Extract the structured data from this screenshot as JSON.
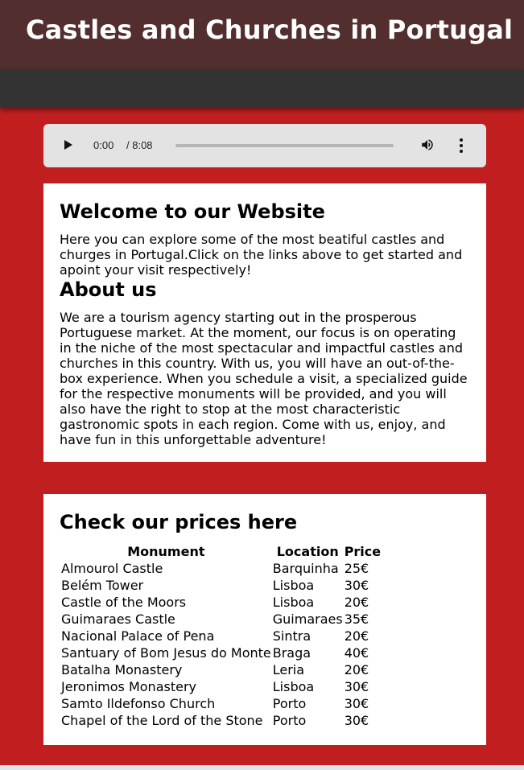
{
  "header": {
    "title": "Castles and Churches in Portugal"
  },
  "audio": {
    "current_time": "0:00",
    "duration": "/ 8:08",
    "progress": 0.0
  },
  "welcome": {
    "heading": "Welcome to our Website",
    "text": "Here you can explore some of the most beatiful castles and churges in Portugal.Click on the links above to get started and apoint your visit respectively!"
  },
  "about": {
    "heading": "About us",
    "text": "We are a tourism agency starting out in the prosperous Portuguese market. At the moment, our focus is on operating in the niche of the most spectacular and impactful castles and churches in this country. With us, you will have an out-of-the-box experience. When you schedule a visit, a specialized guide for the respective monuments will be provided, and you will also have the right to stop at the most characteristic gastronomic spots in each region. Come with us, enjoy, and have fun in this unforgettable adventure!"
  },
  "prices": {
    "heading": "Check our prices here",
    "columns": [
      "Monument",
      "Location",
      "Price"
    ],
    "rows": [
      [
        "Almourol Castle",
        "Barquinha",
        "25€"
      ],
      [
        "Belém Tower",
        "Lisboa",
        "30€"
      ],
      [
        "Castle of the Moors",
        "Lisboa",
        "20€"
      ],
      [
        "Guimaraes Castle",
        "Guimaraes",
        "35€"
      ],
      [
        "Nacional Palace of Pena",
        "Sintra",
        "20€"
      ],
      [
        "Santuary of Bom Jesus do Monte",
        "Braga",
        "40€"
      ],
      [
        "Batalha Monastery",
        "Leria",
        "20€"
      ],
      [
        "Jeronimos Monastery",
        "Lisboa",
        "30€"
      ],
      [
        "Samto Ildefonso Church",
        "Porto",
        "30€"
      ],
      [
        "Chapel of the Lord of the Stone",
        "Porto",
        "30€"
      ]
    ]
  }
}
